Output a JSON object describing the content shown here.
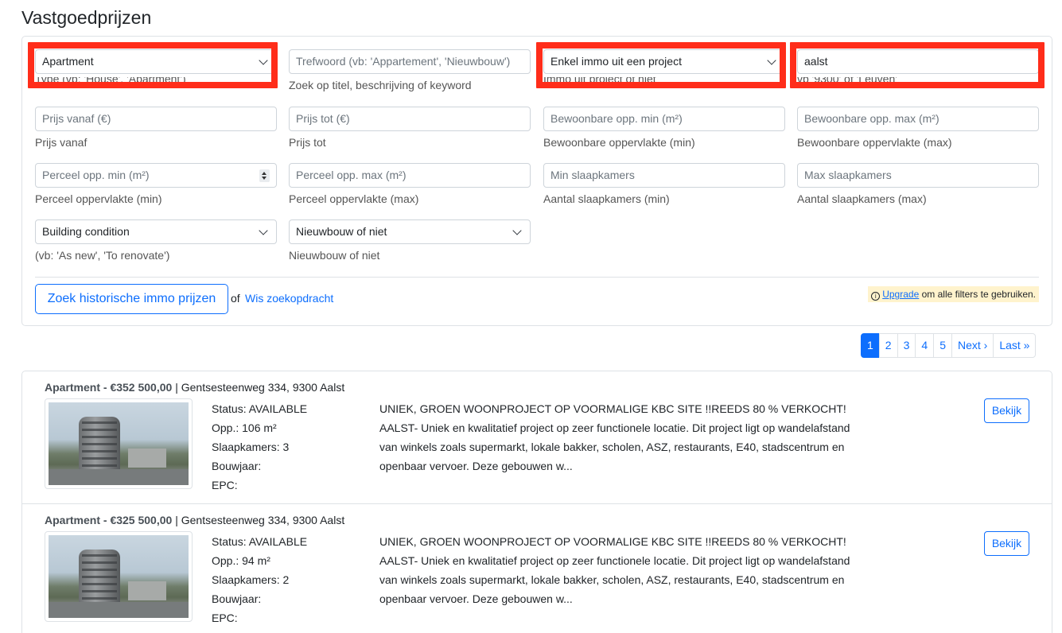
{
  "page": {
    "title": "Vastgoedprijzen"
  },
  "filters": {
    "row1": [
      {
        "value": "Apartment",
        "help": "Type (vb: 'House', 'Apartment')"
      },
      {
        "placeholder": "Trefwoord (vb: 'Appartement', 'Nieuwbouw')",
        "help": "Zoek op titel, beschrijving of keyword"
      },
      {
        "value": "Enkel immo uit een project",
        "help": "Immo uit project of niet"
      },
      {
        "value": "aalst",
        "help": "vb '9300' of 'Leuven'"
      }
    ],
    "row2": [
      {
        "placeholder": "Prijs vanaf (€)",
        "help": "Prijs vanaf"
      },
      {
        "placeholder": "Prijs tot (€)",
        "help": "Prijs tot"
      },
      {
        "placeholder": "Bewoonbare opp. min (m²)",
        "help": "Bewoonbare oppervlakte (min)"
      },
      {
        "placeholder": "Bewoonbare opp. max (m²)",
        "help": "Bewoonbare oppervlakte (max)"
      }
    ],
    "row3": [
      {
        "placeholder": "Perceel opp. min (m²)",
        "help": "Perceel oppervlakte (min)"
      },
      {
        "placeholder": "Perceel opp. max (m²)",
        "help": "Perceel oppervlakte (max)"
      },
      {
        "placeholder": "Min slaapkamers",
        "help": "Aantal slaapkamers (min)"
      },
      {
        "placeholder": "Max slaapkamers",
        "help": "Aantal slaapkamers (max)"
      }
    ],
    "row4": [
      {
        "value": "Building condition",
        "help": "(vb: 'As new', 'To renovate')"
      },
      {
        "value": "Nieuwbouw of niet",
        "help": "Nieuwbouw of niet"
      }
    ],
    "search_button": "Zoek historische immo prijzen",
    "or_text": "of",
    "clear_link": "Wis zoekopdracht",
    "upgrade_link": "Upgrade",
    "upgrade_text": "om alle filters te gebruiken.",
    "highlight_color": "#ff2d1a"
  },
  "pagination": {
    "pages": [
      "1",
      "2",
      "3",
      "4",
      "5"
    ],
    "active": "1",
    "next": "Next ›",
    "last": "Last »"
  },
  "results": [
    {
      "title": "Apartment - €352 500,00",
      "address": "| Gentsesteenweg 334, 9300 Aalst",
      "status": "Status: AVAILABLE",
      "area": "Opp.: 106 m²",
      "bedrooms": "Slaapkamers: 3",
      "year": "Bouwjaar:",
      "epc": "EPC:",
      "description": "UNIEK, GROEN WOONPROJECT OP VOORMALIGE KBC SITE !!REEDS 80 % VERKOCHT! AALST- Uniek en kwalitatief project op zeer functionele locatie. Dit project ligt op wandelafstand van winkels zoals supermarkt, lokale bakker, scholen, ASZ, restaurants, E40, stadscentrum en openbaar vervoer. Deze gebouwen w...",
      "view_label": "Bekijk"
    },
    {
      "title": "Apartment - €325 500,00",
      "address": "| Gentsesteenweg 334, 9300 Aalst",
      "status": "Status: AVAILABLE",
      "area": "Opp.: 94 m²",
      "bedrooms": "Slaapkamers: 2",
      "year": "Bouwjaar:",
      "epc": "EPC:",
      "description": "UNIEK, GROEN WOONPROJECT OP VOORMALIGE KBC SITE !!REEDS 80 % VERKOCHT! AALST- Uniek en kwalitatief project op zeer functionele locatie. Dit project ligt op wandelafstand van winkels zoals supermarkt, lokale bakker, scholen, ASZ, restaurants, E40, stadscentrum en openbaar vervoer. Deze gebouwen w...",
      "view_label": "Bekijk"
    }
  ]
}
